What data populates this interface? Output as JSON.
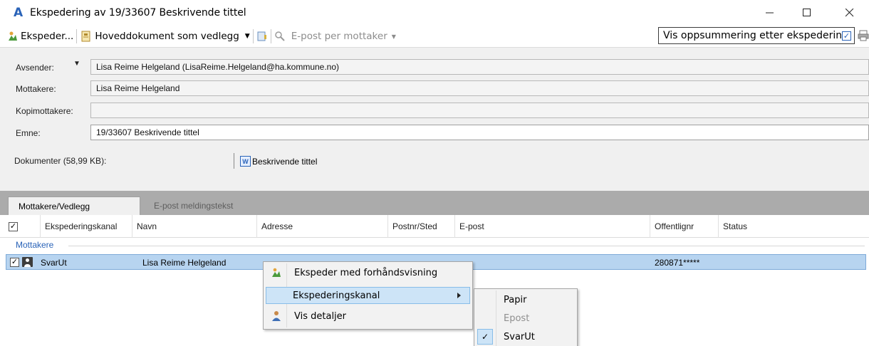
{
  "window": {
    "title": "Ekspedering av 19/33607 Beskrivende tittel",
    "app_icon_letter": "A"
  },
  "toolbar": {
    "ekspeder_label": "Ekspeder...",
    "hoveddokument_label": "Hoveddokument som vedlegg",
    "epost_per_mottaker_label": "E-post per mottaker",
    "vis_oppsummering_label": "Vis oppsummering etter ekspedering",
    "vis_oppsummering_checked": true
  },
  "form": {
    "avsender_label": "Avsender:",
    "avsender_value": "Lisa Reime Helgeland (LisaReime.Helgeland@ha.kommune.no)",
    "mottakere_label": "Mottakere:",
    "mottakere_value": "Lisa Reime Helgeland",
    "kopimottakere_label": "Kopimottakere:",
    "kopimottakere_value": "",
    "emne_label": "Emne:",
    "emne_value": "19/33607 Beskrivende tittel",
    "dokumenter_label": "Dokumenter (58,99 KB):",
    "document_name": "Beskrivende tittel"
  },
  "tabs": [
    {
      "label": "Mottakere/Vedlegg",
      "active": true
    },
    {
      "label": "E-post meldingstekst",
      "active": false
    }
  ],
  "grid": {
    "columns": [
      "Ekspederingskanal",
      "Navn",
      "Adresse",
      "Postnr/Sted",
      "E-post",
      "Offentlignr",
      "Status"
    ],
    "group_label": "Mottakere",
    "rows": [
      {
        "checked": true,
        "kanal": "SvarUt",
        "navn": "Lisa Reime Helgeland",
        "adresse": "",
        "postnr": "",
        "epost": "",
        "offentlignr": "280871*****",
        "status": ""
      }
    ]
  },
  "context_menu": {
    "items": [
      {
        "label": "Ekspeder med forhåndsvisning",
        "icon": "ekspeder-icon"
      },
      {
        "label": "Ekspederingskanal",
        "icon": "",
        "has_submenu": true
      },
      {
        "label": "Vis detaljer",
        "icon": "person-details-icon"
      }
    ]
  },
  "submenu": {
    "items": [
      {
        "label": "Papir",
        "enabled": true,
        "checked": false
      },
      {
        "label": "Epost",
        "enabled": false,
        "checked": false
      },
      {
        "label": "SvarUt",
        "enabled": true,
        "checked": true
      }
    ]
  }
}
